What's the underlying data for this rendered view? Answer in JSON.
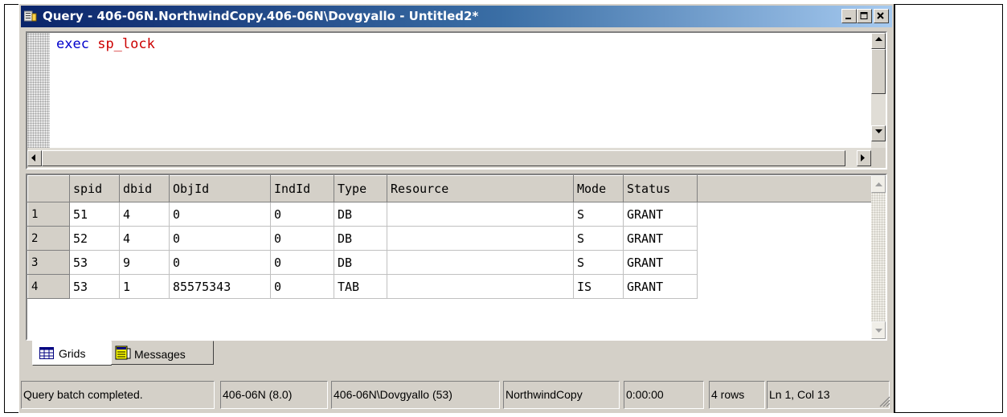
{
  "window": {
    "title": "Query - 406-06N.NorthwindCopy.406-06N\\Dovgyallo - Untitled2*"
  },
  "editor": {
    "keyword": "exec",
    "procedure": "sp_lock"
  },
  "results": {
    "columns": [
      "spid",
      "dbid",
      "ObjId",
      "IndId",
      "Type",
      "Resource",
      "Mode",
      "Status"
    ],
    "rows": [
      {
        "num": "1",
        "cells": [
          "51",
          "4",
          "0",
          "0",
          "DB",
          "",
          "S",
          "GRANT"
        ]
      },
      {
        "num": "2",
        "cells": [
          "52",
          "4",
          "0",
          "0",
          "DB",
          "",
          "S",
          "GRANT"
        ]
      },
      {
        "num": "3",
        "cells": [
          "53",
          "9",
          "0",
          "0",
          "DB",
          "",
          "S",
          "GRANT"
        ]
      },
      {
        "num": "4",
        "cells": [
          "53",
          "1",
          "85575343",
          "0",
          "TAB",
          "",
          "IS",
          "GRANT"
        ]
      }
    ]
  },
  "tabs": {
    "grids": "Grids",
    "messages": "Messages"
  },
  "status": {
    "message": "Query batch completed.",
    "server": "406-06N (8.0)",
    "user": "406-06N\\Dovgyallo (53)",
    "database": "NorthwindCopy",
    "elapsed": "0:00:00",
    "rows": "4 rows",
    "position": "Ln 1, Col 13"
  },
  "colors": {
    "title_bar": "#0a246a",
    "face": "#d4d0c8",
    "keyword": "#0000cc",
    "procedure": "#cc0000"
  }
}
